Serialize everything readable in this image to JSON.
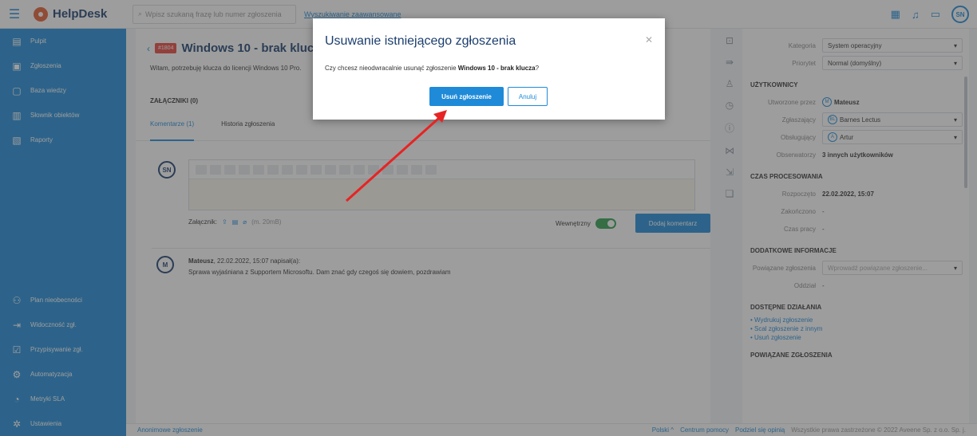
{
  "app": {
    "name": "HelpDesk",
    "search_placeholder": "Wpisz szukaną frazę lub numer zgłoszenia",
    "advanced_search": "Wyszukiwanie zaawansowane",
    "user_initials": "SN"
  },
  "sidebar": {
    "items": [
      {
        "label": "Pulpit",
        "icon": "dashboard-icon"
      },
      {
        "label": "Zgłoszenia",
        "icon": "tickets-icon"
      },
      {
        "label": "Baza wiedzy",
        "icon": "book-icon"
      },
      {
        "label": "Słownik obiektów",
        "icon": "dictionary-icon"
      },
      {
        "label": "Raporty",
        "icon": "report-icon"
      }
    ],
    "bottom_items": [
      {
        "label": "Plan nieobecności",
        "icon": "absence-icon"
      },
      {
        "label": "Widoczność zgł.",
        "icon": "visibility-icon"
      },
      {
        "label": "Przypisywanie zgł.",
        "icon": "assign-icon"
      },
      {
        "label": "Automatyzacja",
        "icon": "automation-icon"
      },
      {
        "label": "Metryki SLA",
        "icon": "sla-icon"
      },
      {
        "label": "Ustawienia",
        "icon": "settings-icon"
      }
    ]
  },
  "ticket": {
    "id": "#1804",
    "title": "Windows 10 - brak klucza",
    "description": "Witam, potrzebuję klucza do licencji Windows 10 Pro.",
    "attachments_label": "ZAŁĄCZNIKI (0)",
    "tabs": [
      "Komentarze (1)",
      "Historia zgłoszenia"
    ],
    "editor_avatar": "SN",
    "attach_label": "Załącznik:",
    "attach_size": "(m. 20mB)",
    "internal_label": "Wewnętrzny",
    "add_comment": "Dodaj komentarz",
    "comment": {
      "avatar": "M",
      "author": "Mateusz",
      "meta": ", 22.02.2022, 15:07 napisał(a):",
      "text": "Sprawa wyjaśniana z Supportem Microsoftu. Dam znać gdy czegoś się dowiem, pozdrawiam"
    }
  },
  "details": {
    "category_label": "Kategoria",
    "category_value": "System operacyjny",
    "priority_label": "Priorytet",
    "priority_value": "Normal (domyślny)",
    "users_section": "UŻYTKOWNICY",
    "created_by_label": "Utworzone przez",
    "created_by_value": "Mateusz",
    "reporter_label": "Zgłaszający",
    "reporter_value": "Barnes Lectus",
    "handler_label": "Obsługujący",
    "handler_value": "Artur",
    "observers_label": "Obserwatorzy",
    "observers_value": "3 innych użytkowników",
    "time_section": "CZAS PROCESOWANIA",
    "started_label": "Rozpoczęto",
    "started_value": "22.02.2022, 15:07",
    "closed_label": "Zakończono",
    "closed_value": "-",
    "worktime_label": "Czas pracy",
    "worktime_value": "-",
    "extra_section": "DODATKOWE INFORMACJE",
    "related_label": "Powiązane zgłoszenia",
    "related_placeholder": "Wprowadź powiązane zgłoszenie...",
    "dept_label": "Oddział",
    "dept_value": "-",
    "actions_section": "DOSTĘPNE DZIAŁANIA",
    "actions": [
      "• Wydrukuj zgłoszenie",
      "• Scal zgłoszenie z innym",
      "• Usuń zgłoszenie"
    ],
    "linked_section": "POWIĄZANE ZGŁOSZENIA"
  },
  "footer": {
    "left": "Anonimowe zgłoszenie",
    "lang": "Polski ^",
    "help": "Centrum pomocy",
    "share": "Podziel się opinią",
    "copyright": "Wszystkie prawa zastrzeżone © 2022 Aveene Sp. z o.o. Sp. j."
  },
  "modal": {
    "title": "Usuwanie istniejącego zgłoszenia",
    "text_prefix": "Czy chcesz nieodwracalnie usunąć zgłoszenie ",
    "ticket_name": "Windows 10 - brak klucza",
    "text_suffix": "?",
    "confirm": "Usuń zgłoszenie",
    "cancel": "Anuluj"
  },
  "colors": {
    "accent": "#1f8ad8",
    "annotation_arrow": "#e82323",
    "ticket_badge": "#e8453c"
  }
}
